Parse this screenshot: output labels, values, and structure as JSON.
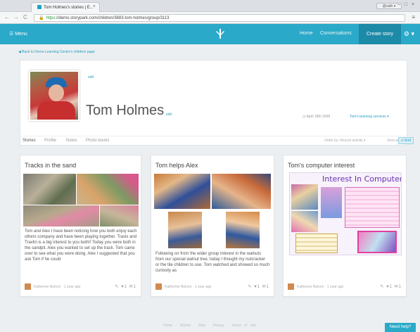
{
  "browser": {
    "tab_title": "Tom Holmes's stories | E...",
    "tab_close": "×",
    "user_badge": "@cath ▾",
    "window_controls": "– □ ×",
    "back": "←",
    "forward": "→",
    "reload": "C",
    "url_scheme": "https",
    "url_rest": "://demo.storypark.com/children/3883-tom-holmes/group/3113",
    "menu": "≡"
  },
  "appnav": {
    "menu_label": "☰ Menu",
    "home_label": "Home",
    "conversations_label": "Conversations",
    "create_story_label": "Create story",
    "settings_label": "⚙ ▾"
  },
  "back_link": "◀ Back to Demo Learning Centre's children page",
  "profile": {
    "photo_edit": "edit",
    "name": "Tom Holmes",
    "name_edit": "edit",
    "birthday": "◷ April 18th 2008",
    "settings_link": "Tom's learning services ▾",
    "tabs": [
      "Stories",
      "Profile",
      "Notes",
      "Photo books"
    ],
    "sort_label": "Order by: Recent activity ▾",
    "view_label": "View as",
    "view_toggle": "≡ Grid"
  },
  "cards": [
    {
      "title": "Tracks in the sand",
      "text": "Tom and Alex I have been noticing how you both enjoy each others company and have been playing together. Travis and Travlin is a big interest to you both!! Today you were both in the sandpit. Alex you wanted to set up the track. Tom came over to see what you were doing. Alex I suggested that you ask Tom if he could",
      "author": "Katherine Nelson · 1 year ago",
      "icons": "✎ ♥1 ✉1"
    },
    {
      "title": "Tom helps Alex",
      "text": "Following on from the wider group interest in the walnuts from our special walnut tree, today I thought my nutcracker or the tile children to use. Tom watched and showed so much curiosity as",
      "author": "Katherine Nelson · 1 year ago",
      "icons": "✎ ♥1 ✉1"
    },
    {
      "title": "Tom's computer interest",
      "poster_heading": "Interest In Computers",
      "author": "Katherine Nelson · 1 year ago",
      "icons": "✎ ♥1 ✉1"
    }
  ],
  "footer": {
    "links": "Home · Stories · Help · Privacy · Terms of use"
  },
  "help_button": "Need help?"
}
